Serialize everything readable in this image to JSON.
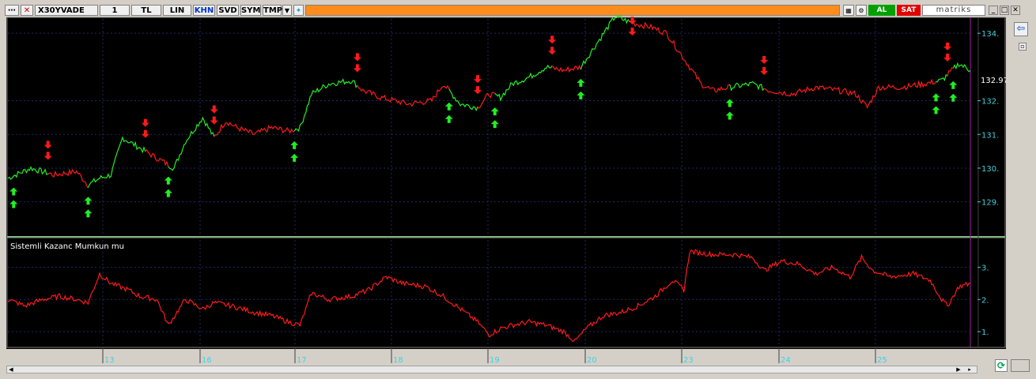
{
  "toolbar": {
    "symbol": "X30YVADE",
    "period": "1",
    "currency": "TL",
    "scale": "LIN",
    "khn": "KHN",
    "svd": "SVD",
    "sym": "SYM",
    "tmp": "TMP",
    "buy_label": "AL",
    "sell_label": "SAT",
    "brand": "matriks"
  },
  "colors": {
    "up": "#22ee22",
    "down": "#ff1a1a",
    "axis_text": "#40d0e0",
    "grid": "#1c2a66",
    "accent": "#ff8c1a"
  },
  "price_panel": {
    "last_price": "132.975",
    "y_ticks": [
      "134.",
      "132.",
      "131.",
      "130.",
      "129."
    ]
  },
  "indicator_panel": {
    "title": "Sistemli Kazanc Mumkun mu",
    "y_ticks": [
      "3.",
      "2.",
      "1."
    ]
  },
  "time_axis": {
    "labels": [
      "13",
      "16",
      "17",
      "18",
      "19",
      "20",
      "23",
      "24",
      "25"
    ]
  },
  "chart_data": {
    "type": "line",
    "series": [
      {
        "points": [
          [
            0,
            129.7
          ],
          [
            4,
            130.0
          ],
          [
            8,
            129.8
          ],
          [
            12,
            129.9
          ],
          [
            14,
            129.5
          ],
          [
            16,
            129.7
          ],
          [
            18,
            129.8
          ],
          [
            20,
            130.9
          ],
          [
            24,
            130.5
          ],
          [
            27,
            130.2
          ],
          [
            29,
            130.0
          ],
          [
            31,
            130.8
          ],
          [
            34,
            131.5
          ],
          [
            36,
            130.9
          ],
          [
            38,
            131.4
          ],
          [
            40,
            131.2
          ],
          [
            43,
            131.0
          ],
          [
            46,
            131.2
          ],
          [
            49,
            131.1
          ],
          [
            51,
            131.2
          ],
          [
            53,
            132.2
          ],
          [
            56,
            132.5
          ],
          [
            60,
            132.6
          ],
          [
            62,
            132.3
          ],
          [
            65,
            132.1
          ],
          [
            70,
            131.9
          ],
          [
            74,
            132.0
          ],
          [
            76,
            132.5
          ],
          [
            79,
            131.9
          ],
          [
            82,
            131.8
          ],
          [
            84,
            132.2
          ],
          [
            86,
            132.1
          ],
          [
            88,
            132.5
          ],
          [
            91,
            132.7
          ],
          [
            94,
            133.0
          ],
          [
            97,
            132.9
          ],
          [
            100,
            133.0
          ],
          [
            102,
            133.5
          ],
          [
            104,
            134.0
          ],
          [
            106,
            134.5
          ],
          [
            109,
            134.3
          ],
          [
            112,
            134.2
          ],
          [
            115,
            134.0
          ],
          [
            117,
            133.5
          ],
          [
            119,
            133.0
          ],
          [
            121,
            132.5
          ],
          [
            123,
            132.3
          ],
          [
            126,
            132.4
          ],
          [
            130,
            132.5
          ],
          [
            133,
            132.3
          ],
          [
            137,
            132.2
          ],
          [
            141,
            132.4
          ],
          [
            145,
            132.3
          ],
          [
            148,
            132.2
          ],
          [
            150,
            131.8
          ],
          [
            152,
            132.4
          ],
          [
            156,
            132.4
          ],
          [
            160,
            132.5
          ],
          [
            163,
            132.6
          ],
          [
            166,
            133.1
          ],
          [
            168,
            132.9
          ]
        ]
      },
      {
        "name": "Sistemli Kazanc Mumkun mu",
        "points": [
          [
            0,
            2.0
          ],
          [
            3,
            1.8
          ],
          [
            6,
            2.0
          ],
          [
            9,
            2.1
          ],
          [
            12,
            2.0
          ],
          [
            14,
            1.9
          ],
          [
            16,
            2.8
          ],
          [
            18,
            2.5
          ],
          [
            21,
            2.3
          ],
          [
            23,
            2.1
          ],
          [
            26,
            2.0
          ],
          [
            28,
            1.2
          ],
          [
            31,
            2.0
          ],
          [
            34,
            1.7
          ],
          [
            36,
            1.9
          ],
          [
            39,
            1.8
          ],
          [
            43,
            1.6
          ],
          [
            46,
            1.5
          ],
          [
            49,
            1.3
          ],
          [
            51,
            1.2
          ],
          [
            53,
            2.2
          ],
          [
            56,
            2.0
          ],
          [
            60,
            2.1
          ],
          [
            63,
            2.3
          ],
          [
            66,
            2.7
          ],
          [
            69,
            2.5
          ],
          [
            73,
            2.4
          ],
          [
            76,
            2.1
          ],
          [
            79,
            1.7
          ],
          [
            82,
            1.3
          ],
          [
            84,
            0.9
          ],
          [
            86,
            1.1
          ],
          [
            88,
            1.2
          ],
          [
            91,
            1.3
          ],
          [
            94,
            1.2
          ],
          [
            97,
            1.0
          ],
          [
            99,
            0.7
          ],
          [
            101,
            1.1
          ],
          [
            104,
            1.5
          ],
          [
            107,
            1.6
          ],
          [
            110,
            1.8
          ],
          [
            113,
            2.1
          ],
          [
            116,
            2.6
          ],
          [
            118,
            2.3
          ],
          [
            119,
            3.5
          ],
          [
            123,
            3.4
          ],
          [
            127,
            3.4
          ],
          [
            130,
            3.3
          ],
          [
            132,
            2.9
          ],
          [
            135,
            3.2
          ],
          [
            138,
            3.1
          ],
          [
            141,
            2.8
          ],
          [
            144,
            3.0
          ],
          [
            147,
            2.7
          ],
          [
            149,
            3.3
          ],
          [
            151,
            2.9
          ],
          [
            154,
            2.7
          ],
          [
            158,
            2.8
          ],
          [
            161,
            2.6
          ],
          [
            163,
            2.0
          ],
          [
            164,
            1.8
          ],
          [
            166,
            2.4
          ],
          [
            168,
            2.5
          ]
        ]
      }
    ],
    "buy_signals": [
      1,
      14,
      28,
      50,
      77,
      85,
      100,
      126,
      162,
      165
    ],
    "sell_signals": [
      7,
      24,
      36,
      61,
      82,
      95,
      109,
      132,
      164
    ]
  }
}
